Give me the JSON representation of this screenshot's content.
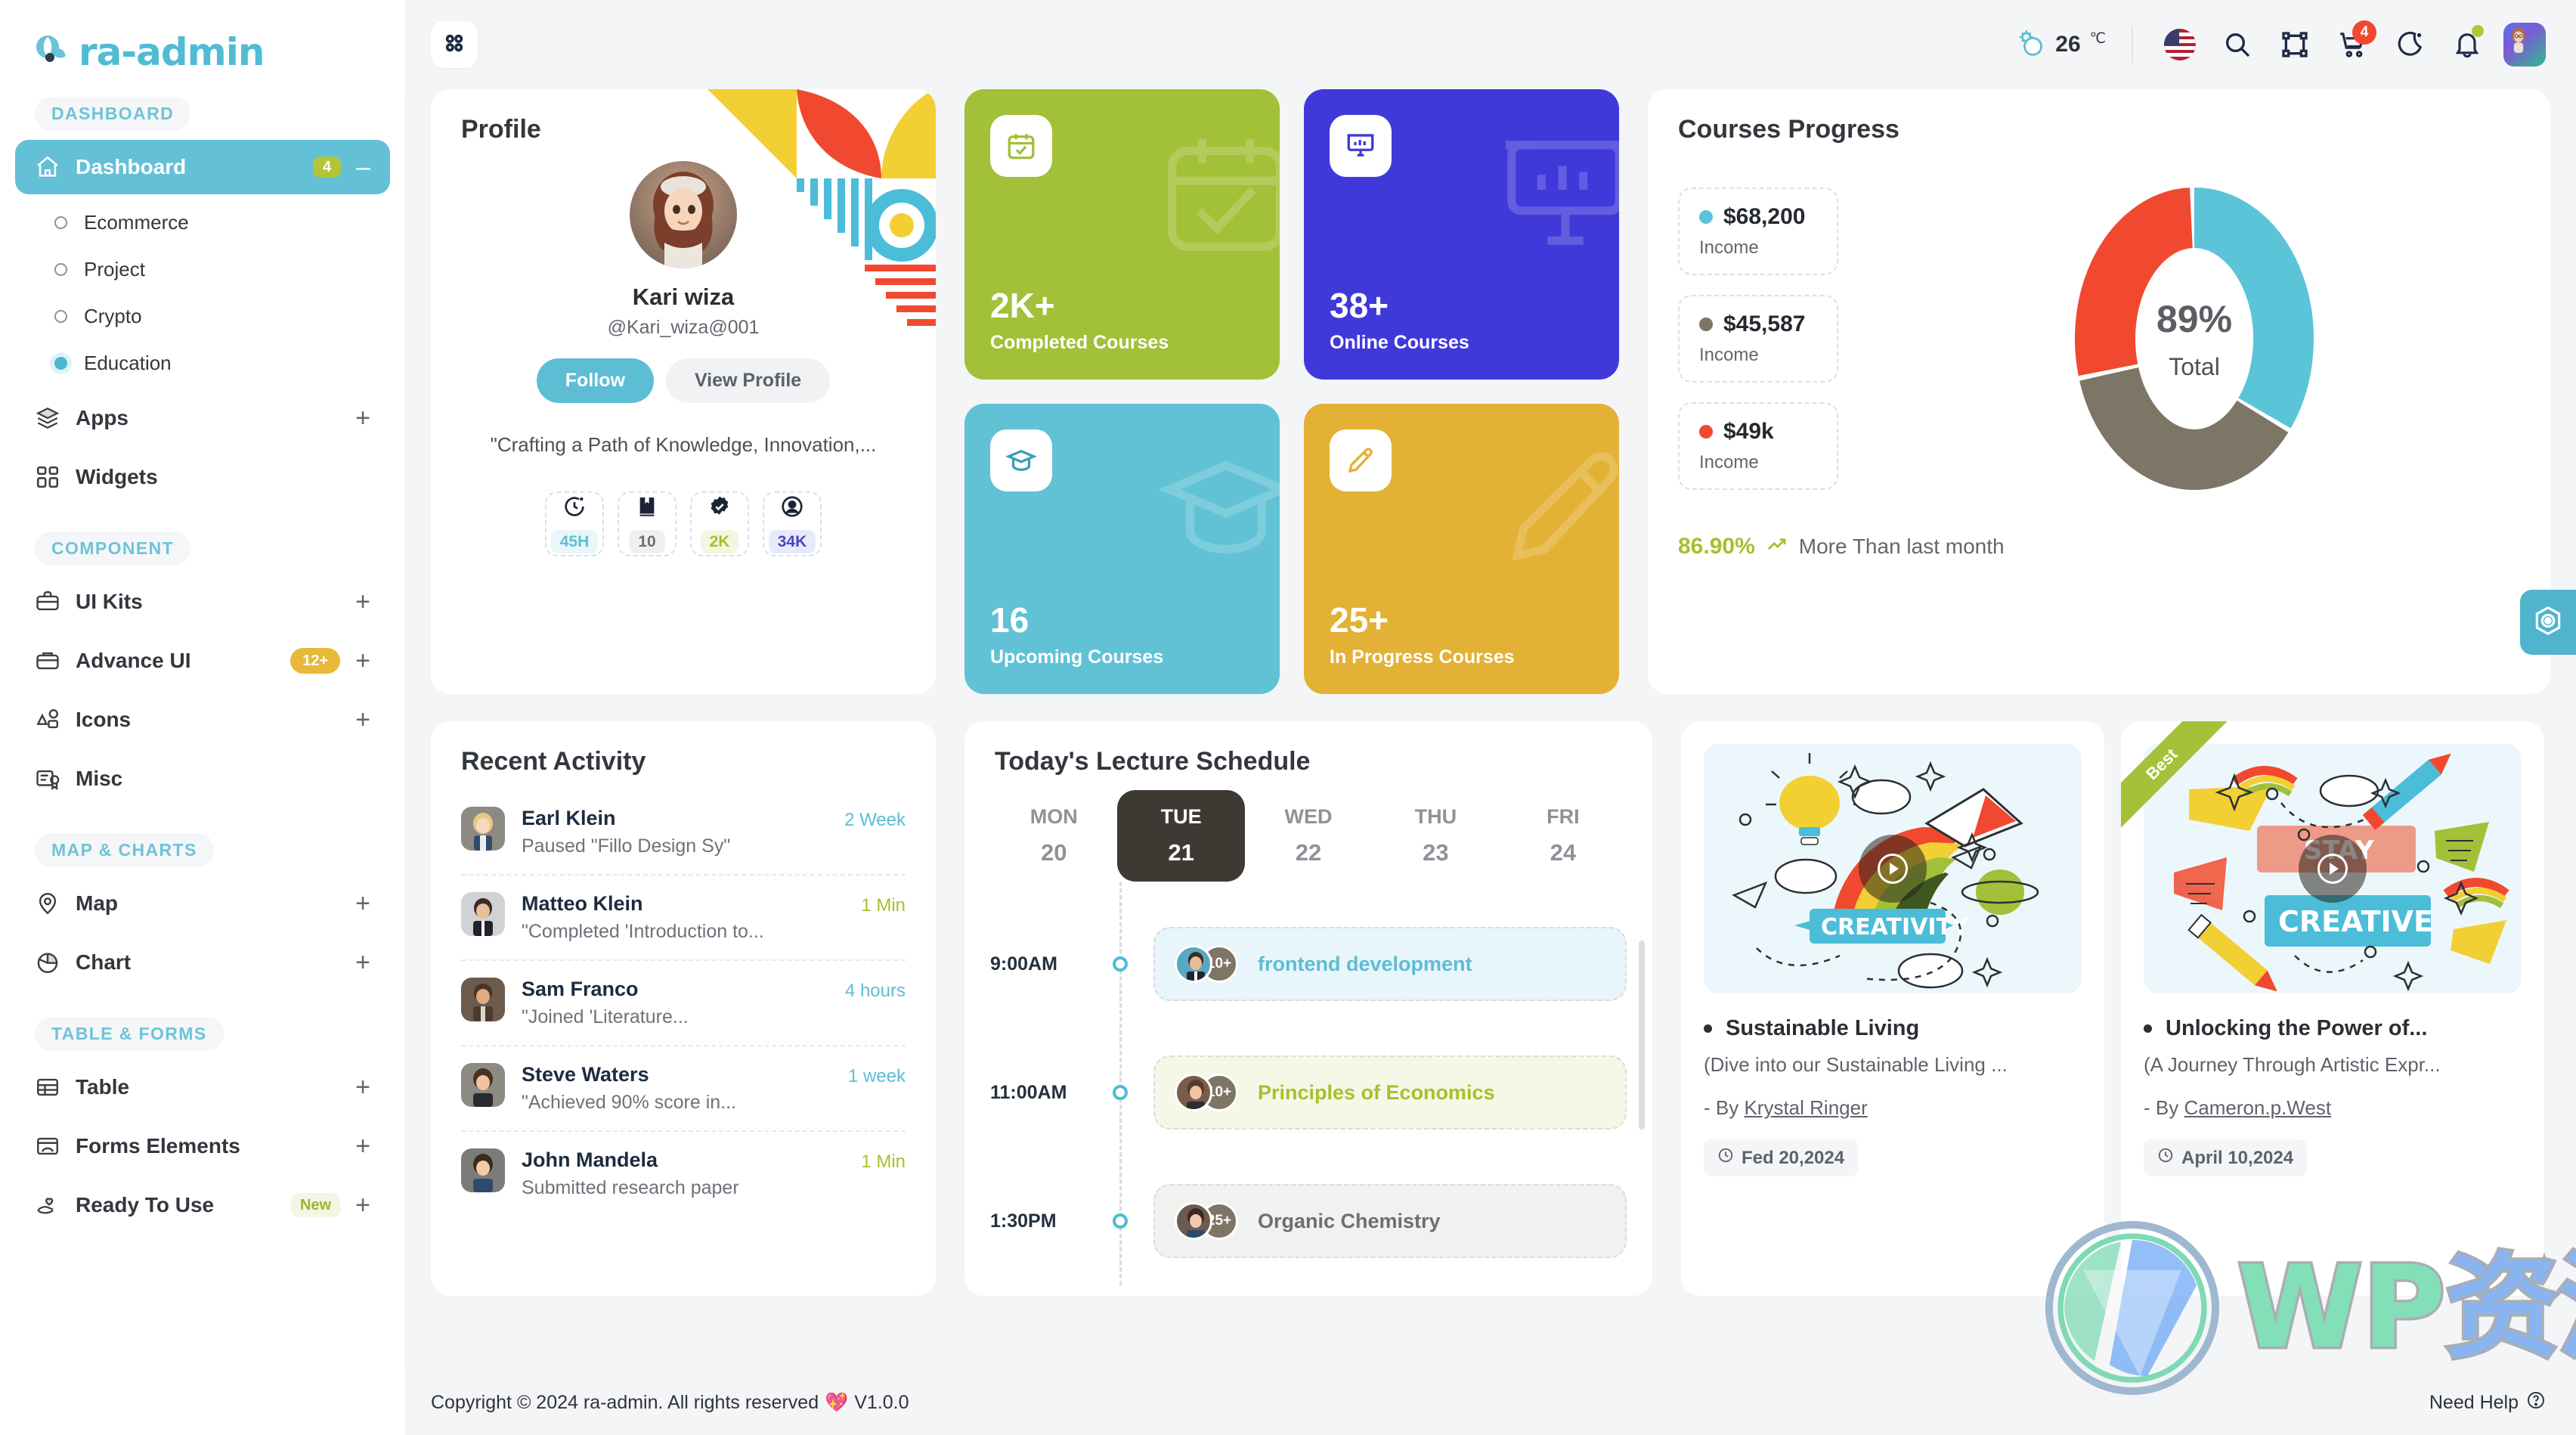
{
  "brand": {
    "name": "ra-admin",
    "accent": "#4fbcd4"
  },
  "sidebar": {
    "sections": [
      {
        "label": "DASHBOARD"
      },
      {
        "label": "COMPONENT"
      },
      {
        "label": "MAP & CHARTS"
      },
      {
        "label": "TABLE & FORMS"
      }
    ],
    "dashboard": {
      "label": "Dashboard",
      "badge": "4",
      "collapse": "–"
    },
    "sub_items": [
      {
        "label": "Ecommerce",
        "active": false
      },
      {
        "label": "Project",
        "active": false
      },
      {
        "label": "Crypto",
        "active": false
      },
      {
        "label": "Education",
        "active": true
      }
    ],
    "items": [
      {
        "label": "Apps",
        "icon": "layers-icon",
        "expand": "+"
      },
      {
        "label": "Widgets",
        "icon": "widgets-icon",
        "expand": ""
      },
      {
        "label": "UI Kits",
        "icon": "briefcase-icon",
        "expand": "+"
      },
      {
        "label": "Advance UI",
        "icon": "suitcase-icon",
        "badge": "12+",
        "expand": "+"
      },
      {
        "label": "Icons",
        "icon": "shapes-icon",
        "expand": "+"
      },
      {
        "label": "Misc",
        "icon": "certificate-icon",
        "expand": ""
      },
      {
        "label": "Map",
        "icon": "map-pin-icon",
        "expand": "+"
      },
      {
        "label": "Chart",
        "icon": "pie-chart-icon",
        "expand": "+"
      },
      {
        "label": "Table",
        "icon": "table-icon",
        "expand": "+"
      },
      {
        "label": "Forms Elements",
        "icon": "form-icon",
        "expand": "+"
      },
      {
        "label": "Ready To Use",
        "icon": "hand-heart-icon",
        "badge": "New",
        "expand": "+"
      }
    ]
  },
  "topbar": {
    "menu_icon": "grid-dots-icon",
    "weather": {
      "icon": "sun-cloud-icon",
      "temp": "26",
      "unit": "℃"
    },
    "icons": [
      {
        "name": "language-flag-us"
      },
      {
        "name": "search-icon"
      },
      {
        "name": "fullscreen-icon"
      },
      {
        "name": "cart-icon",
        "badge": "4"
      },
      {
        "name": "dark-mode-moon-icon"
      },
      {
        "name": "notification-bell-icon",
        "dot": true
      }
    ],
    "avatar": "user-avatar"
  },
  "profile": {
    "title": "Profile",
    "name": "Kari wiza",
    "handle": "@Kari_wiza@001",
    "follow_label": "Follow",
    "view_label": "View Profile",
    "quote": "\"Crafting a Path of Knowledge, Innovation,...",
    "stats": [
      {
        "icon": "clock-sparkle-icon",
        "value": "45H",
        "color": "#5dbdd4",
        "bg": "#e9f7fa"
      },
      {
        "icon": "book-bookmark-icon",
        "value": "10",
        "color": "#6b6f75",
        "bg": "#f0efec"
      },
      {
        "icon": "verified-badge-icon",
        "value": "2K",
        "color": "#a8bf2d",
        "bg": "#f3f7de"
      },
      {
        "icon": "user-circle-icon",
        "value": "34K",
        "color": "#4a45c9",
        "bg": "#e9eaf9"
      }
    ]
  },
  "tiles": [
    {
      "value": "2K+",
      "label": "Completed Courses",
      "bg": "#a2c038",
      "icon": "calendar-check-icon"
    },
    {
      "value": "38+",
      "label": "Online Courses",
      "bg": "#4039d9",
      "icon": "presentation-chart-icon"
    },
    {
      "value": "16",
      "label": "Upcoming Courses",
      "bg": "#61c2d6",
      "icon": "graduation-cap-icon"
    },
    {
      "value": "25+",
      "label": "In Progress Courses",
      "bg": "#e3b135",
      "icon": "pencil-icon"
    }
  ],
  "courses_progress": {
    "title": "Courses Progress",
    "legend": [
      {
        "value": "$68,200",
        "sub": "Income",
        "color": "#5cc4d8"
      },
      {
        "value": "$45,587",
        "sub": "Income",
        "color": "#7d7565"
      },
      {
        "value": "$49k",
        "sub": "Income",
        "color": "#f0492f"
      }
    ],
    "center_pct": "89%",
    "center_label": "Total",
    "footer_pct": "86.90%",
    "footer_text": "More Than last month",
    "footer_icon": "trend-up-icon"
  },
  "chart_data": {
    "type": "pie",
    "title": "Courses Progress",
    "labels": [
      "Income $68,200",
      "Income $45,587",
      "Income $49k"
    ],
    "values": [
      68200,
      45587,
      49000
    ],
    "colors": [
      "#5cc4d8",
      "#7d7565",
      "#f0492f"
    ],
    "donut": true,
    "center_text": "89%",
    "center_subtext": "Total",
    "legend_position": "left",
    "grid": false,
    "annotation": "86.90% More Than last month"
  },
  "recent_activity": {
    "title": "Recent Activity",
    "rows": [
      {
        "name": "Earl Klein",
        "desc": "Paused \"Fillo Design Sy\"",
        "time": "2 Week",
        "time_color": "#5dbdd4",
        "av": "#8d8a84"
      },
      {
        "name": "Matteo Klein",
        "desc": "\"Completed 'Introduction to...",
        "time": "1 Min",
        "time_color": "#a8bf2d",
        "av": "#cfd3d6"
      },
      {
        "name": "Sam Franco",
        "desc": "\"Joined 'Literature...",
        "time": "4 hours",
        "time_color": "#5dbdd4",
        "av": "#6c5b4c"
      },
      {
        "name": "Steve Waters",
        "desc": "\"Achieved 90% score in...",
        "time": "1 week",
        "time_color": "#5dbdd4",
        "av": "#8d8a84"
      },
      {
        "name": "John Mandela",
        "desc": "Submitted research paper",
        "time": "1 Min",
        "time_color": "#a8bf2d",
        "av": "#7d7b78"
      }
    ]
  },
  "schedule": {
    "title": "Today's Lecture Schedule",
    "days": [
      {
        "dn": "MON",
        "dd": "20",
        "active": false
      },
      {
        "dn": "TUE",
        "dd": "21",
        "active": true
      },
      {
        "dn": "WED",
        "dd": "22",
        "active": false
      },
      {
        "dn": "THU",
        "dd": "23",
        "active": false
      },
      {
        "dn": "FRI",
        "dd": "24",
        "active": false
      }
    ],
    "rows": [
      {
        "time": "9:00AM",
        "title": "frontend development",
        "count": "10+",
        "bg": "#e8f5fa",
        "color": "#5dbdd4",
        "av": "#5aa7c4"
      },
      {
        "time": "11:00AM",
        "title": "Principles of Economics",
        "count": "10+",
        "bg": "#f5f8e6",
        "color": "#a8bf2d",
        "av": "#7a5c4a"
      },
      {
        "time": "1:30PM",
        "title": "Organic Chemistry",
        "count": "25+",
        "bg": "#f1f1ef",
        "color": "#6b6f75",
        "av": "#6d5b52"
      }
    ]
  },
  "course_cards": [
    {
      "title": "Sustainable Living",
      "subtitle": "(Dive into our Sustainable Living ...",
      "by_prefix": "- By ",
      "author": "Krystal Ringer",
      "date": "Fed 20,2024",
      "date_icon": "clock-icon",
      "ribbon": "",
      "thumb_word": "CREATIVITY",
      "play_icon": "play-icon"
    },
    {
      "title": "Unlocking the Power of...",
      "subtitle": "(A Journey Through Artistic Expr...",
      "by_prefix": "- By ",
      "author": "Cameron.p.West",
      "date": "April 10,2024",
      "date_icon": "clock-icon",
      "ribbon": "Best",
      "thumb_word": "CREATIVE",
      "play_icon": "play-icon"
    }
  ],
  "fab": {
    "icon": "settings-hex-icon"
  },
  "footer": {
    "copyright": "Copyright © 2024 ra-admin. All rights reserved",
    "heart": "💖",
    "version": "V1.0.0",
    "help": "Need Help",
    "help_icon": "question-circle-icon"
  },
  "watermark": {
    "wp": "WP",
    "cn": "资源海"
  }
}
